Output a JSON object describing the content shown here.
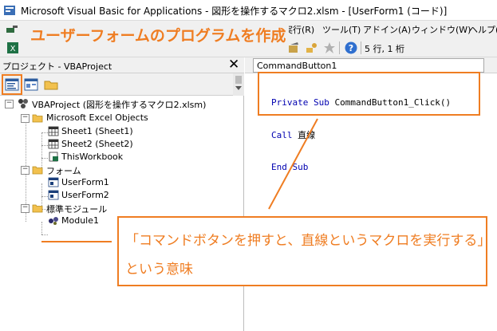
{
  "window": {
    "title": "Microsoft Visual Basic for Applications - 図形を操作するマクロ2.xlsm - [UserForm1 (コード)]"
  },
  "menu": [
    {
      "label": "実行(R)"
    },
    {
      "label": "ツール(T)"
    },
    {
      "label": "アドイン(A)"
    },
    {
      "label": "ウィンドウ(W)"
    },
    {
      "label": "ヘルプ("
    }
  ],
  "toolbar": {
    "position": "5 行, 1 桁",
    "help_icon_glyph": "?"
  },
  "project": {
    "title": "プロジェクト - VBAProject",
    "close_glyph": "✕",
    "tree": [
      {
        "label": "VBAProject (図形を操作するマクロ2.xlsm)",
        "expander": "−"
      },
      {
        "label": "Microsoft Excel Objects",
        "expander": "−"
      },
      {
        "label": "Sheet1 (Sheet1)"
      },
      {
        "label": "Sheet2 (Sheet2)"
      },
      {
        "label": "ThisWorkbook"
      },
      {
        "label": "フォーム",
        "expander": "−"
      },
      {
        "label": "UserForm1"
      },
      {
        "label": "UserForm2"
      },
      {
        "label": "標準モジュール",
        "expander": "−"
      },
      {
        "label": "Module1"
      }
    ]
  },
  "code": {
    "object": "CommandButton1",
    "lines": [
      {
        "keyword": "Private Sub",
        "rest": " CommandButton1_Click()"
      },
      {
        "keyword": "Call",
        "rest": " 直線"
      },
      {
        "keyword": "End Sub",
        "rest": ""
      }
    ]
  },
  "annotation": {
    "headline": "ユーザーフォームのプログラムを作成",
    "explanation_line1": "「コマンドボタンを押すと、直線というマクロを実行する」",
    "explanation_line2": "という意味",
    "accent_color": "#ef7d22"
  },
  "icons": [
    "excel-icon",
    "vba-project-icon",
    "folder-icon",
    "sheet-icon",
    "workbook-icon",
    "userform-icon",
    "module-icon",
    "help-icon",
    "close-icon"
  ]
}
